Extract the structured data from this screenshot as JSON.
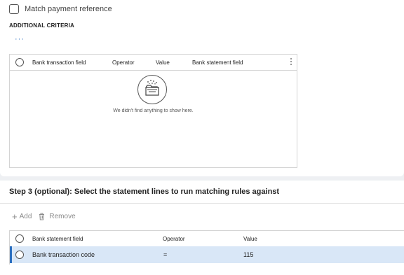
{
  "match_payment": {
    "label": "Match payment reference",
    "checked": false
  },
  "additional_criteria": {
    "heading": "ADDITIONAL CRITERIA",
    "more_label": "···",
    "columns": [
      "Bank transaction field",
      "Operator",
      "Value",
      "Bank statement field"
    ],
    "empty_message": "We didn't find anything to show here."
  },
  "step3": {
    "title": "Step 3 (optional): Select the statement lines to run matching rules against",
    "toolbar": {
      "add_label": "Add",
      "remove_label": "Remove",
      "add_icon": "plus-icon",
      "remove_icon": "trash-icon"
    },
    "columns": [
      "Bank statement field",
      "Operator",
      "Value"
    ],
    "rows": [
      {
        "field": "Bank transaction code",
        "operator": "=",
        "value": "115",
        "selected": true
      }
    ]
  },
  "colors": {
    "accent": "#2b6fbf",
    "selected_row": "#d9e7f7",
    "background": "#eef0f3"
  }
}
